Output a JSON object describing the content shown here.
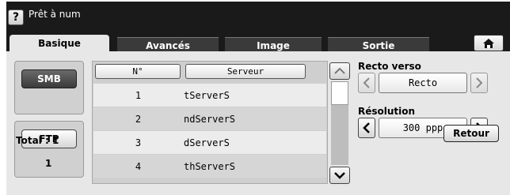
{
  "header": {
    "help_label": "?",
    "title": "Prêt à num"
  },
  "tabs": [
    {
      "label": "Basique",
      "active": true
    },
    {
      "label": "Avancés",
      "active": false
    },
    {
      "label": "Image",
      "active": false
    },
    {
      "label": "Sortie",
      "active": false
    }
  ],
  "home": {
    "icon": "home-icon"
  },
  "protocols": {
    "smb_label": "SMB",
    "ftp_label": "FTP",
    "ftp_count": "1"
  },
  "table": {
    "col_number": "N°",
    "col_server": "Serveur",
    "rows": [
      {
        "n": "1",
        "server": "tServerS"
      },
      {
        "n": "2",
        "server": "ndServerS"
      },
      {
        "n": "3",
        "server": "dServerS"
      },
      {
        "n": "4",
        "server": "thServerS"
      }
    ]
  },
  "duplex": {
    "label": "Recto verso",
    "value": "Recto"
  },
  "resolution": {
    "label": "Résolution",
    "value": "300 ppp"
  },
  "footer": {
    "total": "Total : 1",
    "back_label": "Retour"
  },
  "colors": {
    "titlebar": "#1a1a1a",
    "panel": "#e7e7e7",
    "selected_button": "#4a4a4a"
  }
}
